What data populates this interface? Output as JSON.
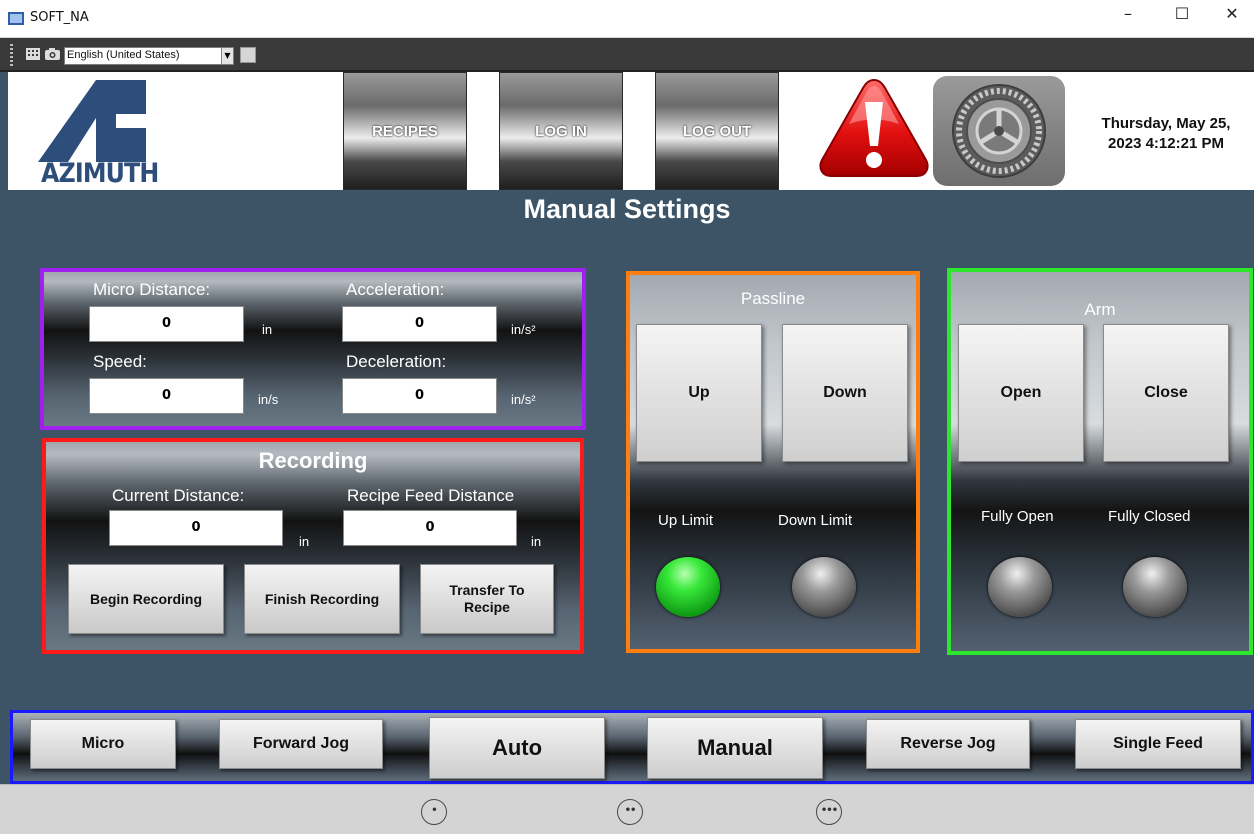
{
  "window": {
    "title": "SOFT_NA",
    "minimize": "–",
    "maximize": "☐",
    "close": "✕"
  },
  "toolbar": {
    "language": "English (United States)",
    "grid_icon": "grid-icon",
    "camera_icon": "camera-icon"
  },
  "header": {
    "logo_text": "AZIMUTH",
    "buttons": {
      "recipes": "RECIPES",
      "log_in": "LOG IN",
      "log_out": "LOG OUT"
    },
    "alarm_icon": "alarm-warning-icon",
    "settings_icon": "gear-icon",
    "date": "Thursday, May 25,",
    "time": "2023 4:12:21 PM"
  },
  "page_title": "Manual Settings",
  "motion": {
    "micro_distance_label": "Micro Distance:",
    "micro_distance_value": "0",
    "micro_distance_unit": "in",
    "acceleration_label": "Acceleration:",
    "acceleration_value": "0",
    "acceleration_unit": "in/s²",
    "speed_label": "Speed:",
    "speed_value": "0",
    "speed_unit": "in/s",
    "deceleration_label": "Deceleration:",
    "deceleration_value": "0",
    "deceleration_unit": "in/s²",
    "border_color": "#a020f0"
  },
  "recording": {
    "title": "Recording",
    "current_distance_label": "Current Distance:",
    "current_distance_value": "0",
    "current_distance_unit": "in",
    "recipe_feed_label": "Recipe Feed Distance",
    "recipe_feed_value": "0",
    "recipe_feed_unit": "in",
    "begin_button": "Begin Recording",
    "finish_button": "Finish Recording",
    "transfer_button_line1": "Transfer To",
    "transfer_button_line2": "Recipe",
    "border_color": "#ff1a1a"
  },
  "passline": {
    "title": "Passline",
    "up_button": "Up",
    "down_button": "Down",
    "up_limit_label": "Up Limit",
    "down_limit_label": "Down Limit",
    "up_limit_on": true,
    "down_limit_on": false,
    "border_color": "#ff7f0e"
  },
  "arm": {
    "title": "Arm",
    "open_button": "Open",
    "close_button": "Close",
    "fully_open_label": "Fully Open",
    "fully_closed_label": "Fully Closed",
    "fully_open_on": false,
    "fully_closed_on": false,
    "border_color": "#2ee62e"
  },
  "mode_bar": {
    "micro": "Micro",
    "forward_jog": "Forward Jog",
    "auto": "Auto",
    "manual": "Manual",
    "reverse_jog": "Reverse Jog",
    "single_feed": "Single Feed",
    "border_color": "#1a1aff"
  },
  "page_nav": [
    "•",
    "••",
    "•••"
  ]
}
